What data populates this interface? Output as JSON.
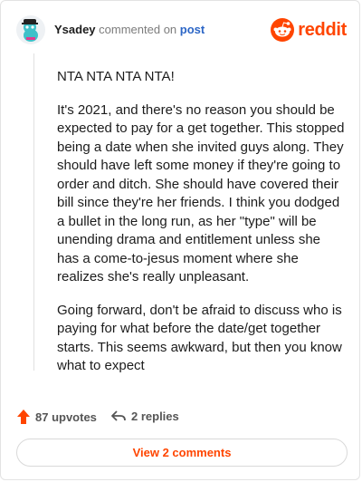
{
  "header": {
    "username": "Ysadey",
    "action": "commented on",
    "post_link": "post",
    "brand": "reddit",
    "avatar_icon": "snoo-avatar-icon",
    "brand_icon": "reddit-logo-icon"
  },
  "comment": {
    "paragraphs": [
      "NTA NTA NTA NTA!",
      "It's 2021, and there's no reason you should be expected to pay for a get together. This stopped being a date when she invited guys along. They should have left some money if they're going to order and ditch. She should have covered their bill since they're her friends. I think you dodged a bullet in the long run, as her \"type\" will be unending drama and entitlement unless she has a come-to-jesus moment where she realizes she's really unpleasant.",
      "Going forward, don't be afraid to discuss who is paying for what before the date/get together starts. This seems awkward, but then you know what to expect"
    ]
  },
  "footer": {
    "upvotes": "87 upvotes",
    "replies": "2 replies",
    "upvote_icon": "upvote-arrow-icon",
    "reply_icon": "reply-arrow-icon"
  },
  "view_button": {
    "label": "View 2 comments"
  },
  "colors": {
    "brand": "#ff4500",
    "link": "#2c66c6",
    "muted": "#7c7c7c"
  }
}
